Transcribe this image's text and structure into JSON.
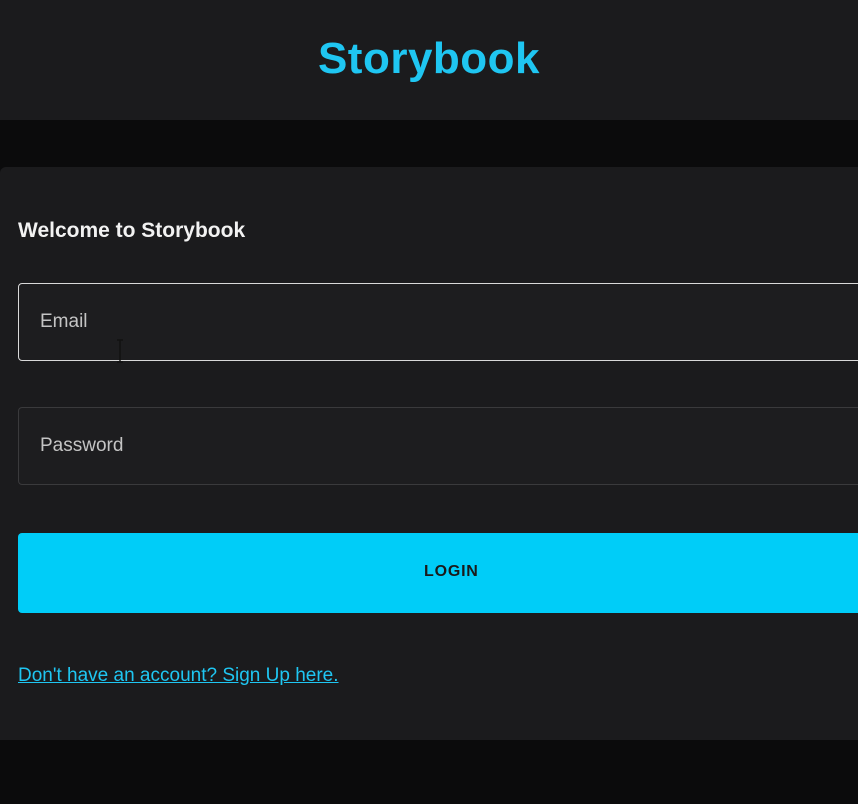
{
  "header": {
    "brand": "Storybook"
  },
  "card": {
    "title": "Welcome to Storybook"
  },
  "form": {
    "email": {
      "placeholder": "Email",
      "value": ""
    },
    "password": {
      "placeholder": "Password",
      "value": ""
    },
    "login_label": "LOGIN"
  },
  "footer": {
    "signup_text": "Don't have an account? Sign Up here."
  },
  "colors": {
    "accent": "#00cdf8",
    "background": "#0b0b0c",
    "surface": "#1b1b1d"
  }
}
